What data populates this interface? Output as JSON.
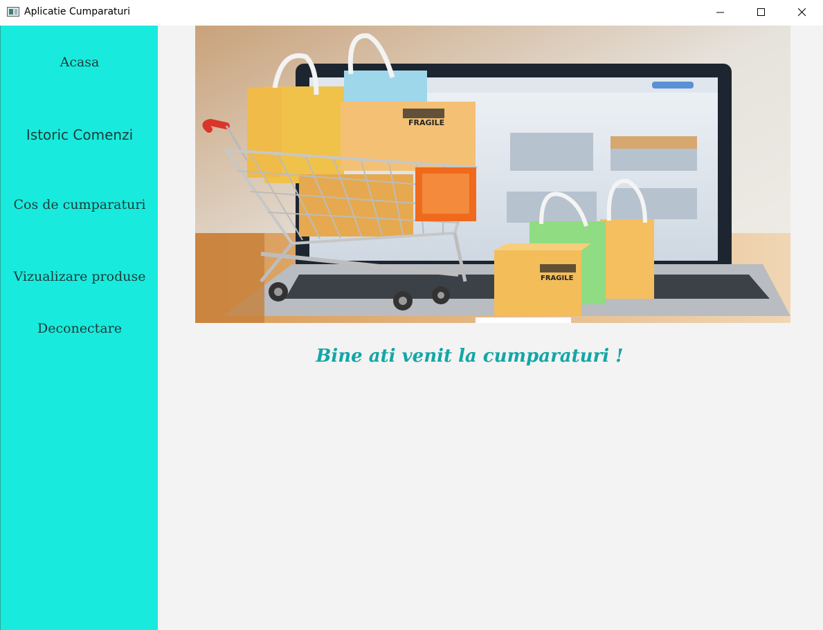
{
  "window": {
    "title": "Aplicatie Cumparaturi",
    "controls": [
      "minimize-icon",
      "maximize-icon",
      "close-icon"
    ]
  },
  "sidebar": {
    "background": "#18ebdd",
    "items": [
      {
        "label": "Acasa"
      },
      {
        "label": "Istoric Comenzi"
      },
      {
        "label": "Cos de cumparaturi"
      },
      {
        "label": "Vizualizare produse"
      },
      {
        "label": "Deconectare"
      }
    ]
  },
  "main": {
    "hero_box_labels": [
      "FRAGILE",
      "FRAGILE"
    ],
    "welcome_text": "Bine ati venit la cumparaturi !",
    "welcome_color": "#13a6a6"
  }
}
